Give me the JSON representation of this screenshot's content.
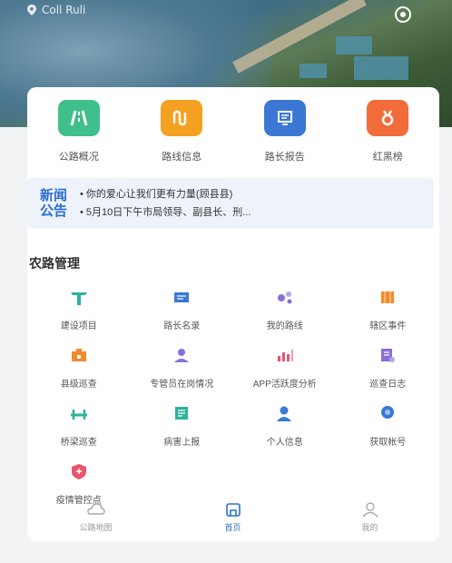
{
  "header": {
    "location_text": "Coll Ruli",
    "settings_icon": "settings-icon"
  },
  "quick_actions": [
    {
      "label": "公路概况",
      "icon": "road-icon",
      "color": "#3fbf8a"
    },
    {
      "label": "路线信息",
      "icon": "route-icon",
      "color": "#f4a020"
    },
    {
      "label": "路长报告",
      "icon": "report-icon",
      "color": "#3a78d4"
    },
    {
      "label": "红黑榜",
      "icon": "ranking-icon",
      "color": "#f26b3a"
    }
  ],
  "news": {
    "tag_line1": "新闻",
    "tag_line2": "公告",
    "items": [
      "• 你的爱心让我们更有力量(顾县县)",
      "• 5月10日下午市局领导、副县长、刑..."
    ]
  },
  "section_title": "农路管理",
  "grid": [
    {
      "label": "建设项目",
      "icon": "construction-icon",
      "color": "#2bb39a"
    },
    {
      "label": "路长名录",
      "icon": "directory-icon",
      "color": "#3a78d4"
    },
    {
      "label": "我的路线",
      "icon": "my-route-icon",
      "color": "#8a6fd8"
    },
    {
      "label": "辖区事件",
      "icon": "event-icon",
      "color": "#f28a2a"
    },
    {
      "label": "县级巡查",
      "icon": "patrol-icon",
      "color": "#f28a2a"
    },
    {
      "label": "专管员在岗情况",
      "icon": "staff-icon",
      "color": "#8a6fd8"
    },
    {
      "label": "APP活跃度分析",
      "icon": "analytics-icon",
      "color": "#e8556d"
    },
    {
      "label": "巡查日志",
      "icon": "log-icon",
      "color": "#8a6fd8"
    },
    {
      "label": "桥梁巡查",
      "icon": "bridge-icon",
      "color": "#2bb39a"
    },
    {
      "label": "病害上报",
      "icon": "damage-report-icon",
      "color": "#2bb39a"
    },
    {
      "label": "个人信息",
      "icon": "profile-icon",
      "color": "#3a78d4"
    },
    {
      "label": "获取帐号",
      "icon": "account-icon",
      "color": "#3a78d4"
    },
    {
      "label": "疫情管控点",
      "icon": "checkpoint-icon",
      "color": "#e8556d"
    }
  ],
  "tabbar": [
    {
      "label": "公路地图",
      "icon": "map-tab-icon",
      "active": false
    },
    {
      "label": "首页",
      "icon": "home-tab-icon",
      "active": true
    },
    {
      "label": "我的",
      "icon": "user-tab-icon",
      "active": false
    }
  ]
}
